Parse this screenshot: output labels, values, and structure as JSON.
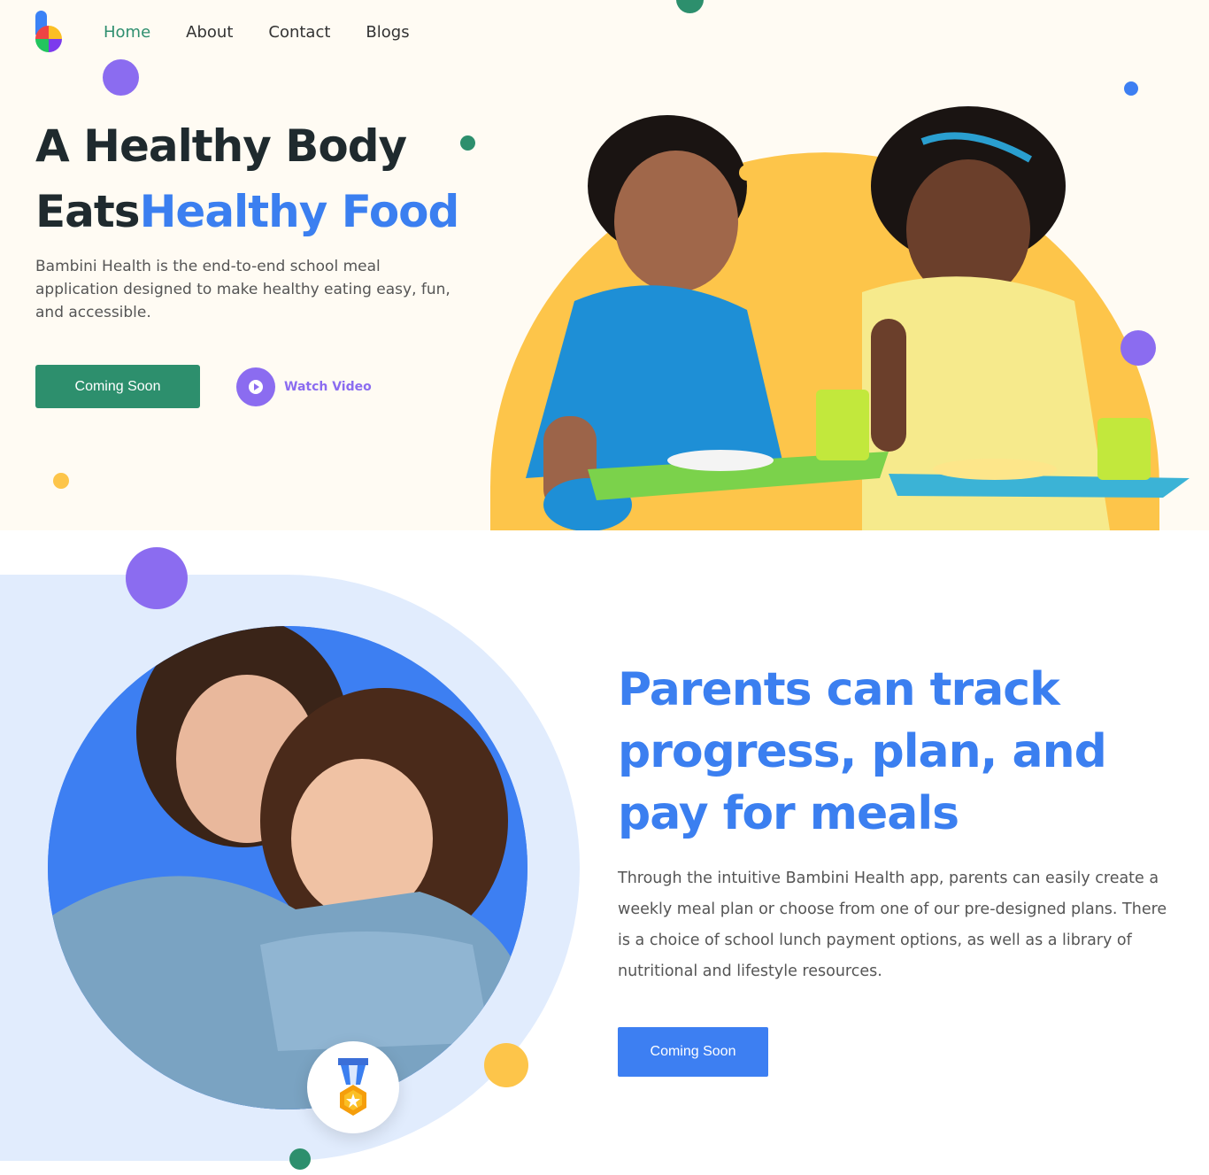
{
  "colors": {
    "hero_bg": "#fffbf3",
    "green": "#2d8f6d",
    "blue": "#3b7ff0",
    "purple": "#8b6cf0",
    "yellow": "#fdc54a",
    "light_blue_panel": "#e1ecfd"
  },
  "nav": {
    "items": [
      {
        "label": "Home",
        "active": true
      },
      {
        "label": "About",
        "active": false
      },
      {
        "label": "Contact",
        "active": false
      },
      {
        "label": "Blogs",
        "active": false
      }
    ]
  },
  "hero": {
    "title_line1": "A Healthy Body",
    "title_line2_dark": "Eats",
    "title_line2_highlight": "Healthy Food",
    "lead": "Bambini Health is the end-to-end school meal application designed to make healthy eating easy, fun, and accessible.",
    "primary_button": "Coming Soon",
    "watch_label": "Watch Video"
  },
  "parents": {
    "title": "Parents can track progress, plan, and pay for meals",
    "body": "Through the intuitive Bambini Health app, parents can easily create a weekly meal plan or choose from one of our pre-designed plans. There is a choice of school lunch payment options, as well as a library of nutritional and lifestyle resources.",
    "button": "Coming Soon",
    "badge_icon": "medal-icon"
  }
}
